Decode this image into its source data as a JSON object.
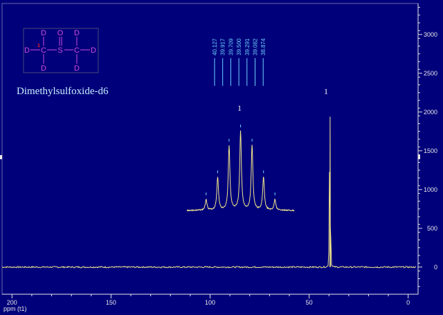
{
  "colors": {
    "background": "#00007b",
    "frame": "#6a6aa8",
    "axis_text": "#e8e8e8",
    "spectrum": "#f4e98a",
    "peak_label": "#6fd2ff",
    "structure": "#d24ad8",
    "structure_highlight": "#ff2020",
    "molecule_name": "#c8f0ff",
    "integral_text": "#f0f0f0"
  },
  "molecule": {
    "name": "Dimethylsulfoxide-d6",
    "atoms": {
      "d": "D",
      "c": "C",
      "s": "S",
      "o": "O"
    },
    "highlight_mark": "1"
  },
  "integral_labels": [
    "1",
    "1"
  ],
  "chart_data": {
    "type": "line",
    "title": "",
    "xlabel": "ppm (t1)",
    "ylabel": "",
    "x_axis": {
      "reversed": true,
      "range": [
        205,
        -5
      ],
      "ticks": [
        200,
        150,
        100,
        50,
        0
      ]
    },
    "y_axis": {
      "range": [
        -350,
        3400
      ],
      "ticks": [
        0,
        500,
        1000,
        1500,
        2000,
        2500,
        3000
      ]
    },
    "grid": false,
    "legend": "none",
    "peak_labels": [
      "40.127",
      "39.917",
      "39.709",
      "39.500",
      "39.291",
      "39.082",
      "38.874"
    ],
    "series": [
      {
        "name": "",
        "peaks": [
          {
            "ppm": 40.127,
            "height": 230
          },
          {
            "ppm": 39.917,
            "height": 560
          },
          {
            "ppm": 39.709,
            "height": 1210
          },
          {
            "ppm": 39.5,
            "height": 1640
          },
          {
            "ppm": 39.291,
            "height": 1210
          },
          {
            "ppm": 39.082,
            "height": 560
          },
          {
            "ppm": 38.874,
            "height": 230
          }
        ]
      }
    ],
    "inset": {
      "peak_heights_relative": [
        0.14,
        0.42,
        0.82,
        1.0,
        0.82,
        0.42,
        0.14
      ]
    }
  }
}
